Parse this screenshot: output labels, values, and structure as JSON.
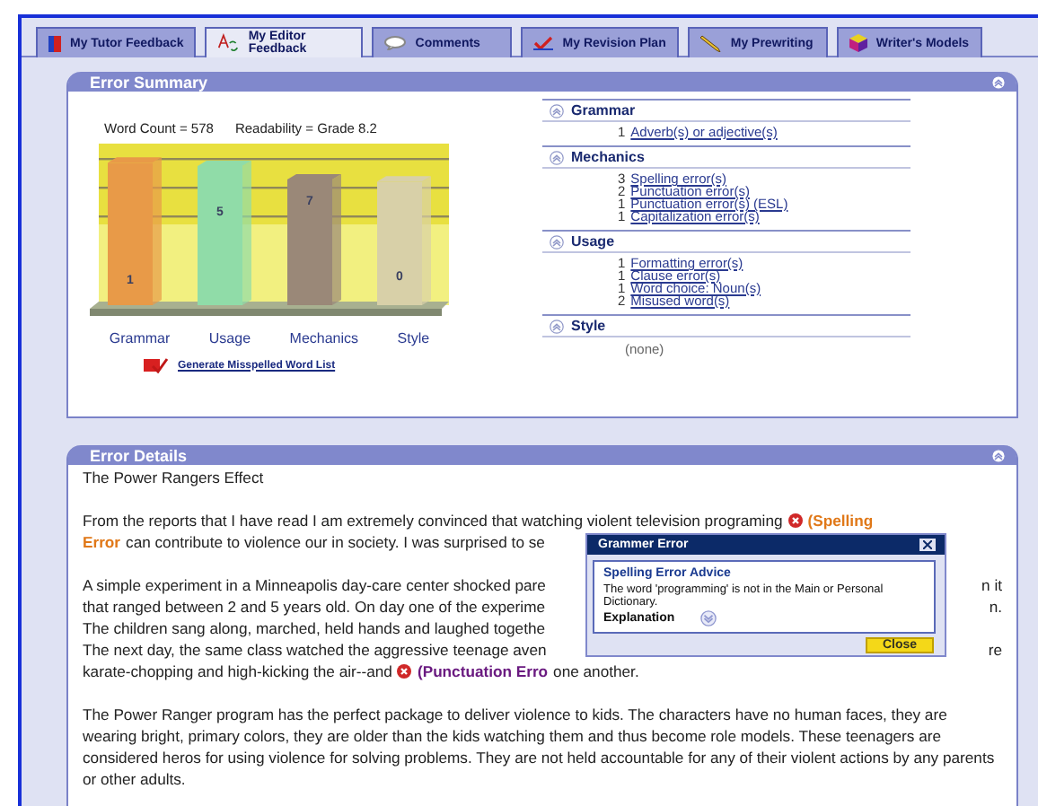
{
  "tabs": [
    {
      "label": "My Tutor Feedback",
      "selected": false
    },
    {
      "label": "My Editor Feedback",
      "selected": true
    },
    {
      "label": "Comments",
      "selected": false
    },
    {
      "label": "My Revision Plan",
      "selected": false
    },
    {
      "label": "My Prewriting",
      "selected": false
    },
    {
      "label": "Writer's Models",
      "selected": false
    }
  ],
  "error_summary": {
    "title": "Error Summary",
    "word_count": "Word Count = 578",
    "readability": "Readability = Grade 8.2",
    "bars": [
      {
        "label": "Grammar",
        "count": "1",
        "color": "#e89a48"
      },
      {
        "label": "Usage",
        "count": "5",
        "color": "#90dca8"
      },
      {
        "label": "Mechanics",
        "count": "7",
        "color": "#9a8878"
      },
      {
        "label": "Style",
        "count": "0",
        "color": "#d8d0a8"
      }
    ],
    "generate_link": "Generate Misspelled Word List",
    "categories": [
      {
        "name": "Grammar",
        "items": [
          {
            "count": "1",
            "label": "Adverb(s) or adjective(s)"
          }
        ]
      },
      {
        "name": "Mechanics",
        "items": [
          {
            "count": "3",
            "label": "Spelling error(s)"
          },
          {
            "count": "2",
            "label": "Punctuation error(s)"
          },
          {
            "count": "1",
            "label": "Punctuation error(s) (ESL)"
          },
          {
            "count": "1",
            "label": "Capitalization error(s)"
          }
        ]
      },
      {
        "name": "Usage",
        "items": [
          {
            "count": "1",
            "label": "Formatting error(s)"
          },
          {
            "count": "1",
            "label": "Clause error(s)"
          },
          {
            "count": "1",
            "label": "Word choice: Noun(s)"
          },
          {
            "count": "2",
            "label": "Misused word(s)"
          }
        ]
      },
      {
        "name": "Style",
        "none": "(none)"
      }
    ]
  },
  "error_details": {
    "title": "Error Details",
    "essay_title": "The Power Rangers Effect",
    "paragraphs": [
      {
        "lines": [
          {
            "parts": [
              {
                "kind": "text",
                "text": "From the reports that I have read I am extremely convinced that watching violent television programing"
              },
              {
                "kind": "error_icon"
              },
              {
                "kind": "spelling",
                "text": "(Spelling"
              }
            ]
          },
          {
            "parts": [
              {
                "kind": "spelling",
                "text": "Error"
              },
              {
                "kind": "text",
                "text": "can contribute to violence our in society. I was surprised to se"
              }
            ]
          }
        ]
      },
      {
        "lines": [
          {
            "parts": [
              {
                "kind": "text",
                "text": "A simple experiment in a Minneapolis day-care center shocked pare"
              }
            ],
            "right": "n it"
          },
          {
            "parts": [
              {
                "kind": "text",
                "text": "that ranged between 2 and 5 years old. On day one of the experime"
              }
            ],
            "right": "n."
          },
          {
            "parts": [
              {
                "kind": "text",
                "text": "The children sang along, marched, held hands and laughed togethe"
              }
            ]
          },
          {
            "parts": [
              {
                "kind": "text",
                "text": "The next day, the same class watched the aggressive teenage aven"
              }
            ],
            "right": "re"
          },
          {
            "parts": [
              {
                "kind": "text",
                "text": "karate-chopping and high-kicking the air--and"
              },
              {
                "kind": "error_icon"
              },
              {
                "kind": "punctuation",
                "text": "(Punctuation Erro"
              },
              {
                "kind": "text",
                "text": "one another."
              }
            ]
          }
        ]
      },
      {
        "text": "The Power Ranger program has the perfect package to deliver violence to kids. The characters have no human faces, they are wearing bright, primary colors, they are older than the kids watching them and thus become role models. These teenagers are considered heros for using violence for solving problems. They are not held accountable for any of their violent actions by any parents or other adults."
      }
    ],
    "popup": {
      "title": "Grammer Error",
      "heading": "Spelling Error Advice",
      "message": "The word 'programming' is not in the Main or Personal Dictionary.",
      "explanation": "Explanation",
      "close": "Close"
    }
  }
}
